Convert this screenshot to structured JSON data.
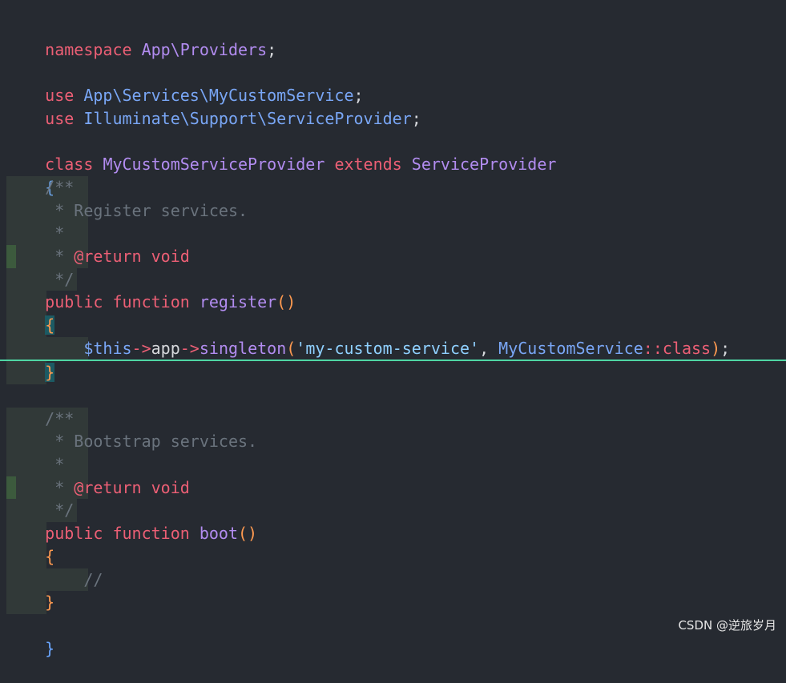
{
  "code": {
    "l1": {
      "kw": "namespace",
      "ns": "App\\Providers",
      "semi": ";"
    },
    "l3": {
      "kw": "use",
      "ns": "App\\Services\\MyCustomService",
      "semi": ";"
    },
    "l4": {
      "kw": "use",
      "ns": "Illuminate\\Support\\ServiceProvider",
      "semi": ";"
    },
    "l6": {
      "kw": "class",
      "name": "MyCustomServiceProvider",
      "kw2": "extends",
      "parent": "ServiceProvider"
    },
    "l7": {
      "brace": "{"
    },
    "doc1": {
      "open": "/**",
      "desc": " * Register services.",
      "star": " *",
      "ret_star": " * ",
      "ret_tag": "@return",
      "ret_type": " void",
      "close": " */"
    },
    "m1": {
      "kw1": "public",
      "kw2": "function",
      "name": "register",
      "parens": "()",
      "open": "{",
      "close": "}"
    },
    "stmt": {
      "var": "$this",
      "arrow1": "->",
      "prop": "app",
      "arrow2": "->",
      "method": "singleton",
      "lparen": "(",
      "str": "'my-custom-service'",
      "comma": ", ",
      "cls": "MyCustomService",
      "dcolon": "::",
      "kwclass": "class",
      "rparen": ")",
      "semi": ";"
    },
    "doc2": {
      "open": "/**",
      "desc": " * Bootstrap services.",
      "star": " *",
      "ret_star": " * ",
      "ret_tag": "@return",
      "ret_type": " void",
      "close": " */"
    },
    "m2": {
      "kw1": "public",
      "kw2": "function",
      "name": "boot",
      "parens": "()",
      "open": "{",
      "comment": "//",
      "close": "}"
    },
    "end": {
      "brace": "}"
    }
  },
  "watermark": "CSDN @逆旅岁月"
}
